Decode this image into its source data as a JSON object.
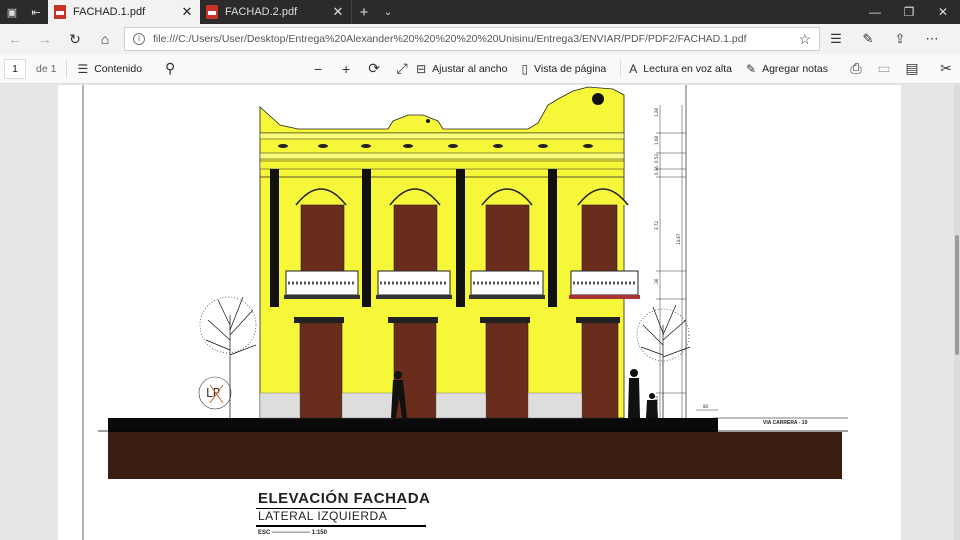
{
  "tabs": [
    {
      "label": "FACHAD.1.pdf",
      "active": true
    },
    {
      "label": "FACHAD.2.pdf",
      "active": false
    }
  ],
  "address": {
    "url": "file:///C:/Users/User/Desktop/Entrega%20Alexander%20%20%20%20%20Unisinu/Entrega3/ENVIAR/PDF/PDF2/FACHAD.1.pdf"
  },
  "pdf_toolbar": {
    "page_current": "1",
    "page_total": "de 1",
    "contents_label": "Contenido",
    "fit_width_label": "Ajustar al ancho",
    "page_view_label": "Vista de página",
    "read_aloud_label": "Lectura en voz alta",
    "add_notes_label": "Agregar notas"
  },
  "drawing": {
    "title": "ELEVACIÓN FACHADA",
    "subtitle": "LATERAL IZQUIERDA",
    "scale": "ESC ------------------- 1:150",
    "street": "VIA CARRERA - 19",
    "monogram": "LP",
    "dimensions": [
      "1.28",
      "1.08",
      "0.53",
      "0.36",
      "3.72",
      "14.67",
      ".36",
      "1.23",
      "80"
    ],
    "colors": {
      "facade": "#f7f73a",
      "ground": "#3a1c10",
      "wood": "#6b2d1b"
    }
  },
  "icons": {
    "back": "arrow-left-icon",
    "forward": "arrow-right-icon",
    "refresh": "refresh-icon",
    "home": "home-icon",
    "favorite": "star-icon"
  }
}
